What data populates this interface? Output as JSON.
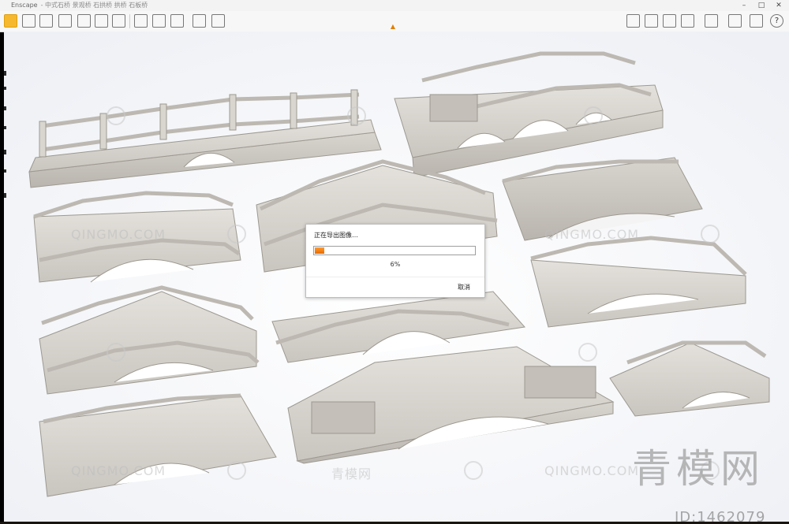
{
  "window": {
    "app_name": "Enscape",
    "title_suffix": "- 中式石桥 景观桥 石拱桥 拱桥 石板桥",
    "controls": {
      "minimize": "–",
      "maximize": "□",
      "close": "✕"
    }
  },
  "toolbar": {
    "tools": [
      {
        "icon": "home-icon",
        "active": true
      },
      {
        "icon": "walk-icon"
      },
      {
        "icon": "fly-icon"
      },
      {
        "icon": "view-icon"
      },
      {
        "icon": "building-icon"
      },
      {
        "icon": "screenshot-icon"
      },
      {
        "icon": "video-icon"
      },
      {
        "icon": "panorama-icon"
      },
      {
        "icon": "export-icon"
      },
      {
        "icon": "render-icon"
      },
      {
        "icon": "batch-icon"
      },
      {
        "icon": "share-icon"
      }
    ],
    "right_tools": [
      {
        "icon": "asset-library-icon"
      },
      {
        "icon": "visual-settings-icon"
      },
      {
        "icon": "material-icon"
      },
      {
        "icon": "sync-icon"
      },
      {
        "icon": "vr-icon"
      },
      {
        "icon": "settings-icon"
      },
      {
        "icon": "feedback-icon"
      }
    ],
    "help_label": "?",
    "collapse_icon": "chevron-up-icon"
  },
  "dialog": {
    "title": "正在导出图像…",
    "progress_text": "6%",
    "progress_value": 0.06,
    "cancel_label": "取消",
    "accent_color": "#f07a10"
  },
  "watermark": {
    "site_text": "QINGMO.COM",
    "cn_text": "青模网",
    "big_text": "青模网",
    "id_text": "ID:1462079"
  }
}
